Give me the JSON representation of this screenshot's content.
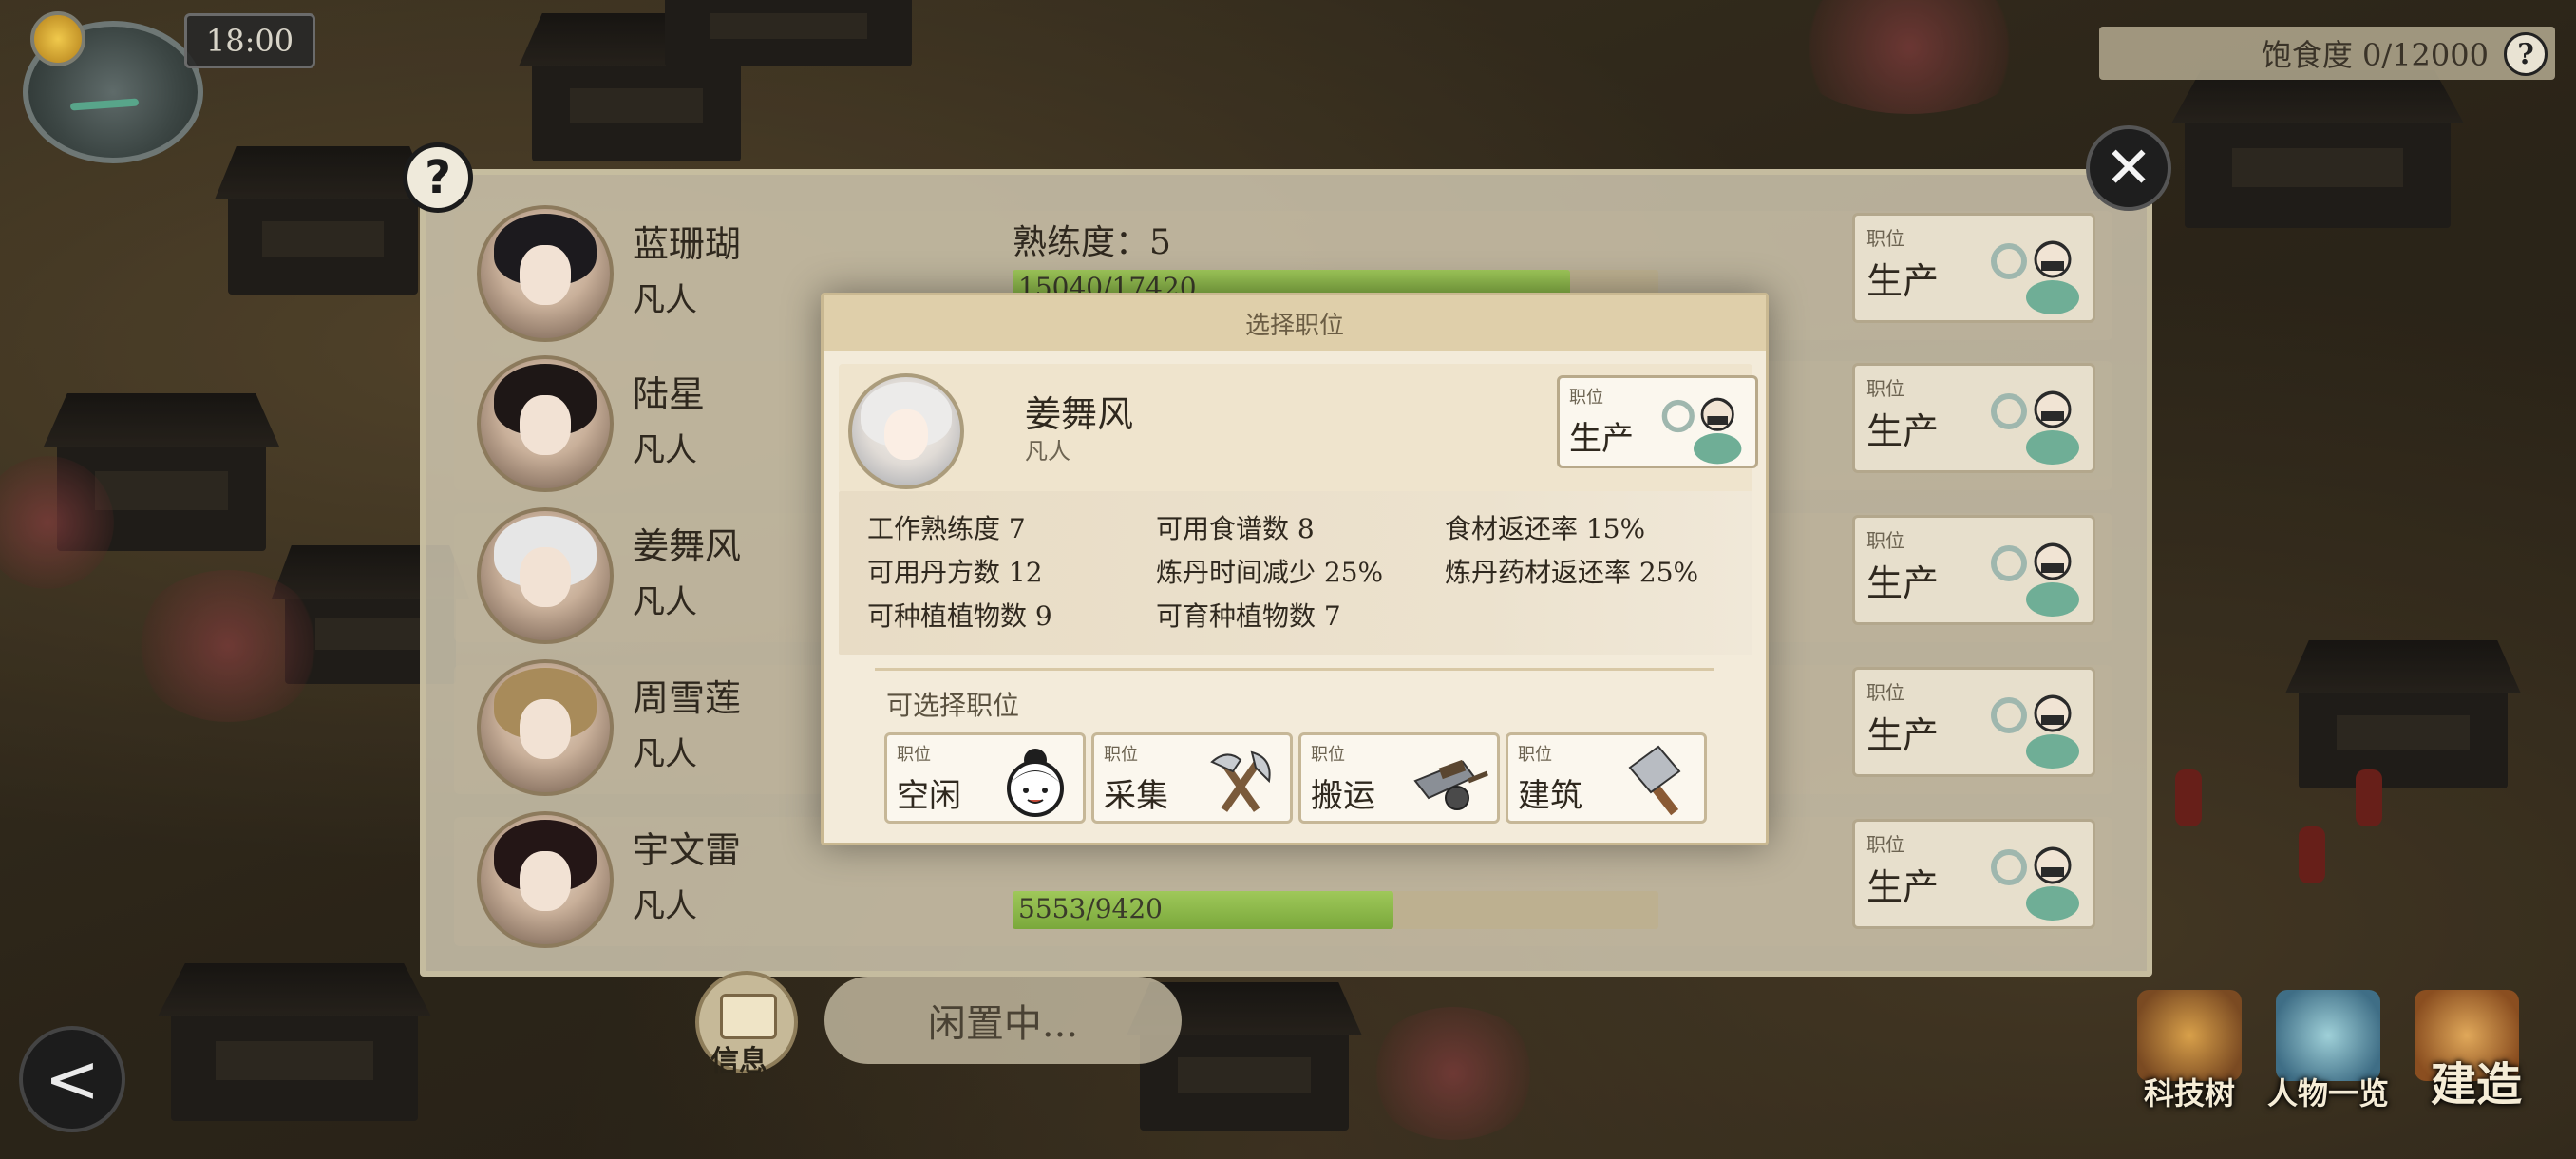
{
  "hud": {
    "time": "18:00",
    "satiety": "饱食度 0/12000",
    "help_glyph": "?"
  },
  "panel": {
    "help_glyph": "?",
    "close_glyph": "✕",
    "rows": [
      {
        "name": "蓝珊瑚",
        "rank": "凡人",
        "proficiency": "熟练度：5",
        "progress": "15040/17420",
        "progress_fraction": 0.863,
        "job_small": "职位",
        "job": "生产"
      },
      {
        "name": "陆星",
        "rank": "凡人",
        "proficiency": "",
        "progress": "",
        "progress_fraction": 0,
        "job_small": "职位",
        "job": "生产"
      },
      {
        "name": "姜舞风",
        "rank": "凡人",
        "proficiency": "",
        "progress": "",
        "progress_fraction": 0,
        "job_small": "职位",
        "job": "生产"
      },
      {
        "name": "周雪莲",
        "rank": "凡人",
        "proficiency": "",
        "progress": "",
        "progress_fraction": 0,
        "job_small": "职位",
        "job": "生产"
      },
      {
        "name": "宇文雷",
        "rank": "凡人",
        "proficiency": "",
        "progress": "5553/9420",
        "progress_fraction": 0.589,
        "job_small": "职位",
        "job": "生产"
      }
    ]
  },
  "modal": {
    "title": "选择职位",
    "hero": {
      "name": "姜舞风",
      "rank": "凡人",
      "job_small": "职位",
      "job": "生产"
    },
    "stats": [
      [
        "工作熟练度 7",
        "可用食谱数 8",
        "食材返还率 15%"
      ],
      [
        "可用丹方数 12",
        "炼丹时间减少 25%",
        "炼丹药材返还率 25%"
      ],
      [
        "可种植植物数 9",
        "可育种植物数 7",
        ""
      ]
    ],
    "available_label": "可选择职位",
    "jobs": [
      {
        "small": "职位",
        "label": "空闲",
        "icon": "idle-face-icon"
      },
      {
        "small": "职位",
        "label": "采集",
        "icon": "axe-pickaxe-icon"
      },
      {
        "small": "职位",
        "label": "搬运",
        "icon": "cart-icon"
      },
      {
        "small": "职位",
        "label": "建筑",
        "icon": "hammer-icon"
      }
    ]
  },
  "bottom": {
    "back_glyph": "<",
    "info_label": "信息",
    "idle_status": "闲置中...",
    "tech": "科技树",
    "roster": "人物一览",
    "build": "建造"
  },
  "colors": {
    "progress_fill": "#7aa83b",
    "panel_bg": "#d6cdb6",
    "modal_bg": "#f3ebda",
    "accent_green": "#58a58a"
  }
}
